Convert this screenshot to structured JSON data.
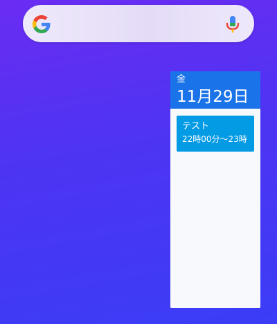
{
  "search_widget": {
    "logo_icon": "google-g-icon",
    "mic_icon": "microphone-icon"
  },
  "calendar_widget": {
    "weekday": "金",
    "date": "11月29日",
    "events": [
      {
        "title": "テスト",
        "time": "22時00分～23時"
      }
    ]
  },
  "colors": {
    "header_blue": "#1a73e8",
    "event_blue": "#049be5"
  }
}
